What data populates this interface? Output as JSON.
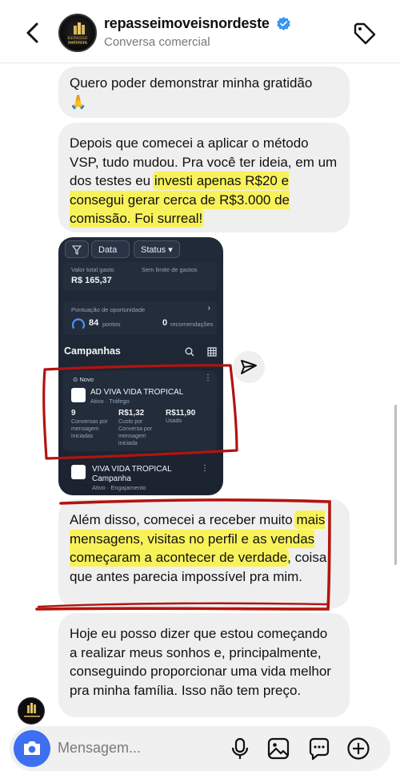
{
  "header": {
    "username": "repasseimoveisnordeste",
    "subtitle": "Conversa comercial",
    "avatar_text": "REPASSE IMÓVEIS",
    "avatar_subtext": "NORDESTE"
  },
  "messages": {
    "m1": {
      "line1": "Quero poder demonstrar minha gratidão",
      "emoji": "🙏"
    },
    "m2": {
      "t1": "Depois que comecei a aplicar o método VSP, tudo mudou. Pra você ter ideia, em um dos testes eu ",
      "h1": "investi apenas R$20 e consegui gerar cerca de R$3.000 de comissão. Foi surreal!"
    },
    "m3": {
      "t1": "Além disso, comecei a receber muito ",
      "h1": "mais mensagens, visitas no perfil e as vendas começaram a acontecer de verdade",
      "t2": ", coisa que antes parecia impossível pra mim."
    },
    "m4": {
      "text": "Hoje eu posso dizer que estou começando a realizar meus sonhos e, principalmente, conseguindo proporcionar uma vida melhor pra minha família. Isso não tem preço."
    }
  },
  "screenshot": {
    "filter_data": "Data",
    "filter_status": "Status",
    "spent_label": "Valor total gasto",
    "spent_value": "R$ 165,37",
    "no_limit": "Sem limite de gastos",
    "score_label": "Pontuação de oportunidade",
    "score_value": "84",
    "score_unit": "pontos",
    "rec_value": "0",
    "rec_label": "recomendações",
    "campaigns_title": "Campanhas",
    "campaign1": {
      "badge": "Novo",
      "name": "AD VIVA VIDA TROPICAL",
      "status": "Ativo · Tráfego",
      "m1_value": "9",
      "m1_label": "Conversas por mensagem iniciadas",
      "m2_value": "R$1,32",
      "m2_label": "Custo por Conversa por mensagem iniciada",
      "m3_value": "R$11,90",
      "m3_label": "Usado"
    },
    "campaign2": {
      "name": "VIVA VIDA TROPICAL Campanha",
      "status": "Ativo · Engajamento"
    }
  },
  "composer": {
    "placeholder": "Mensagem..."
  },
  "colors": {
    "accent_blue": "#3d6ff0",
    "verified": "#3897f0",
    "highlight": "#f8f25a",
    "annotation_red": "#b3140f"
  },
  "icons": [
    "back-chevron-icon",
    "verified-icon",
    "tag-icon",
    "share-icon",
    "camera-icon",
    "microphone-icon",
    "image-icon",
    "sticker-icon",
    "plus-icon"
  ]
}
